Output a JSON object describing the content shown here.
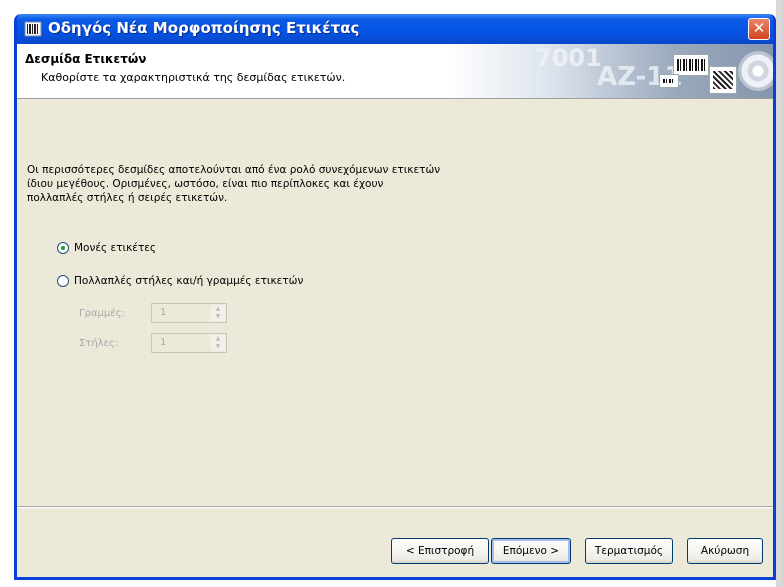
{
  "window": {
    "title": "Οδηγός Νέα Μορφοποίησης Ετικέτας",
    "close_symbol": "✕"
  },
  "header": {
    "title": "Δεσμίδα Ετικετών",
    "subtitle": "Καθορίστε τα χαρακτηριστικά της δεσμίδας ετικετών.",
    "art_text_1": "7001",
    "art_text_2": "AZ-11"
  },
  "content": {
    "description_lines": [
      "Οι περισσότερες δεσμίδες αποτελούνται από ένα ρολό συνεχόμενων ετικετών",
      "ίδιου μεγέθους. Ορισμένες, ωστόσο, είναι πιο περίπλοκες και έχουν",
      "πολλαπλές στήλες ή σειρές ετικετών."
    ],
    "options": [
      {
        "label": "Μονές ετικέτες",
        "checked": true
      },
      {
        "label": "Πολλαπλές στήλες και/ή γραμμές ετικετών",
        "checked": false
      }
    ],
    "rows_label": "Γραμμές:",
    "rows_value": "1",
    "columns_label": "Στήλες:",
    "columns_value": "1"
  },
  "buttons": {
    "back": "< Επιστροφή",
    "next": "Επόμενο >",
    "finish": "Τερματισμός",
    "cancel": "Ακύρωση"
  },
  "colors": {
    "titlebar": "#0553e3",
    "dialog_face": "#ece9d8",
    "close_button": "#d2441e",
    "radio_checked": "#21a121"
  },
  "icons": [
    "app-icon",
    "close-icon",
    "barcode-illustration",
    "disc-illustration",
    "spin-up-icon",
    "spin-down-icon"
  ]
}
